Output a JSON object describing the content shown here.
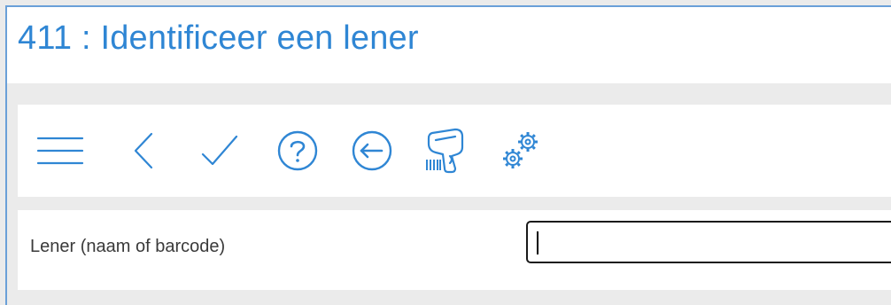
{
  "window": {
    "title": "411 : Identificeer een lener"
  },
  "toolbar": {
    "buttons": [
      {
        "name": "menu",
        "icon": "hamburger-menu-icon"
      },
      {
        "name": "back",
        "icon": "chevron-left-icon"
      },
      {
        "name": "confirm",
        "icon": "checkmark-icon"
      },
      {
        "name": "help",
        "icon": "question-circle-icon"
      },
      {
        "name": "return",
        "icon": "arrow-left-circle-icon"
      },
      {
        "name": "barcode-scanner",
        "icon": "barcode-scanner-icon"
      },
      {
        "name": "settings",
        "icon": "gears-icon"
      }
    ]
  },
  "form": {
    "borrower_label": "Lener (naam of barcode)",
    "borrower_value": ""
  },
  "colors": {
    "accent": "#2f86d4",
    "border": "#6aa0d8"
  }
}
